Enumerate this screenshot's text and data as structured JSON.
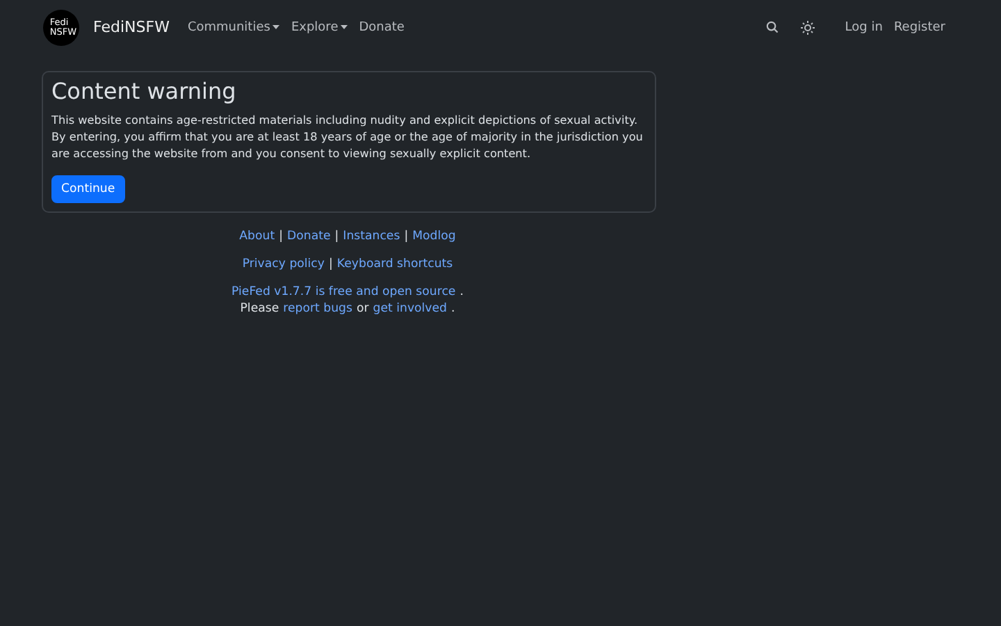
{
  "navbar": {
    "logo_text": [
      "Fedi",
      "NSFW"
    ],
    "brand": "FediNSFW",
    "menu": [
      {
        "label": "Communities",
        "dropdown": true
      },
      {
        "label": "Explore",
        "dropdown": true
      },
      {
        "label": "Donate",
        "dropdown": false
      }
    ],
    "actions": [
      {
        "kind": "search"
      },
      {
        "kind": "theme"
      },
      {
        "kind": "link",
        "label": "Log in"
      },
      {
        "kind": "link",
        "label": "Register"
      }
    ]
  },
  "card": {
    "title": "Content warning",
    "text": "This website contains age-restricted materials including nudity and explicit depictions of sexual activity. By entering, you affirm that you are at least 18 years of age or the age of majority in the jurisdiction you are accessing the website from and you consent to viewing sexually explicit content.",
    "button": "Continue"
  },
  "footer": {
    "lines": [
      [
        {
          "kind": "link",
          "text": "About"
        },
        {
          "kind": "sep",
          "text": "|"
        },
        {
          "kind": "link",
          "text": "Donate"
        },
        {
          "kind": "sep",
          "text": "|"
        },
        {
          "kind": "link",
          "text": "Instances"
        },
        {
          "kind": "sep",
          "text": "|"
        },
        {
          "kind": "link",
          "text": "Modlog"
        }
      ],
      [
        {
          "kind": "link",
          "text": "Privacy policy"
        },
        {
          "kind": "sep",
          "text": "|"
        },
        {
          "kind": "link",
          "text": "Keyboard shortcuts"
        }
      ],
      [
        {
          "kind": "link",
          "text": "PieFed v1.7.7 is free and open source"
        },
        {
          "kind": "text",
          "text": "."
        }
      ],
      [
        {
          "kind": "text",
          "text": "Please"
        },
        {
          "kind": "link",
          "text": "report bugs"
        },
        {
          "kind": "text",
          "text": "or"
        },
        {
          "kind": "link",
          "text": "get involved"
        },
        {
          "kind": "text",
          "text": "."
        }
      ]
    ]
  }
}
